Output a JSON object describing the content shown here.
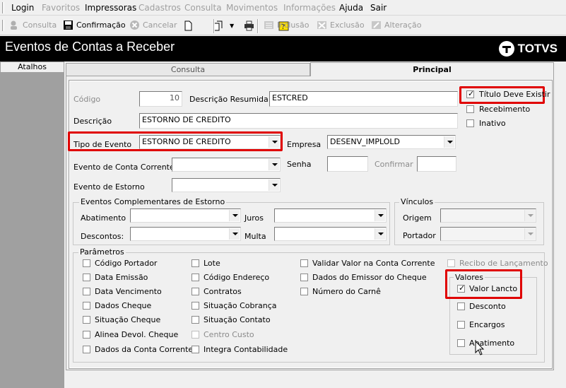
{
  "menu": {
    "items": [
      {
        "label": "Login",
        "enabled": true
      },
      {
        "label": "Favoritos",
        "enabled": false
      },
      {
        "label": "Impressoras",
        "enabled": true
      },
      {
        "label": "Cadastros",
        "enabled": false
      },
      {
        "label": "Consulta",
        "enabled": false
      },
      {
        "label": "Movimentos",
        "enabled": false
      },
      {
        "label": "Informações",
        "enabled": false
      },
      {
        "label": "Ajuda",
        "enabled": true
      },
      {
        "label": "Sair",
        "enabled": true
      }
    ]
  },
  "toolbar": {
    "consulta": "Consulta",
    "confirmacao": "Confirmação",
    "cancelar": "Cancelar",
    "inclusao": "Inclusão",
    "exclusao": "Exclusão",
    "alteracao": "Alteração"
  },
  "window": {
    "title": "Eventos de Contas a Receber",
    "brand": "TOTVS"
  },
  "sidebar": {
    "header": "Atalhos"
  },
  "tabs": {
    "consulta": "Consulta",
    "principal": "Principal"
  },
  "form": {
    "codigo_label": "Código",
    "codigo_value": "10",
    "desc_resumida_label": "Descrição Resumida",
    "desc_resumida_value": "ESTCRED",
    "descricao_label": "Descrição",
    "descricao_value": "ESTORNO DE CREDITO",
    "tipo_evento_label": "Tipo de Evento",
    "tipo_evento_value": "ESTORNO DE CREDITO",
    "empresa_label": "Empresa",
    "empresa_value": "DESENV_IMPLOLD",
    "evento_cc_label": "Evento de Conta Corrente",
    "senha_label": "Senha",
    "confirmar_label": "Confirmar",
    "evento_estorno_label": "Evento de Estorno",
    "titulo_deve_existir": "Título Deve Existir",
    "recebimento": "Recebimento",
    "inativo": "Inativo"
  },
  "complementares": {
    "title": "Eventos Complementares de Estorno",
    "abatimento": "Abatimento",
    "juros": "Juros",
    "descontos": "Descontos:",
    "multa": "Multa"
  },
  "vinculos": {
    "title": "Vínculos",
    "origem": "Origem",
    "portador": "Portador"
  },
  "parametros": {
    "title": "Parâmetros",
    "col1": [
      "Código Portador",
      "Data Emissão",
      "Data Vencimento",
      "Dados Cheque",
      "Situação Cheque",
      "Alinea Devol. Cheque",
      "Dados da Conta Corrente"
    ],
    "col2": [
      "Lote",
      "Código Endereço",
      "Contratos",
      "Situação Cobrança",
      "Situação Contato",
      "Centro Custo",
      "Integra Contabilidade"
    ],
    "col3": [
      "Validar Valor na Conta Corrente",
      "Dados do Emissor do Cheque",
      "Número do Carnê"
    ],
    "recibo": "Recibo de Lançamento"
  },
  "valores": {
    "title": "Valores",
    "items": [
      "Valor Lancto",
      "Desconto",
      "Encargos",
      "Abatimento"
    ]
  },
  "colors": {
    "highlight": "#e00000",
    "titlebar": "#000000",
    "sidebar": "#a0a0a0"
  }
}
